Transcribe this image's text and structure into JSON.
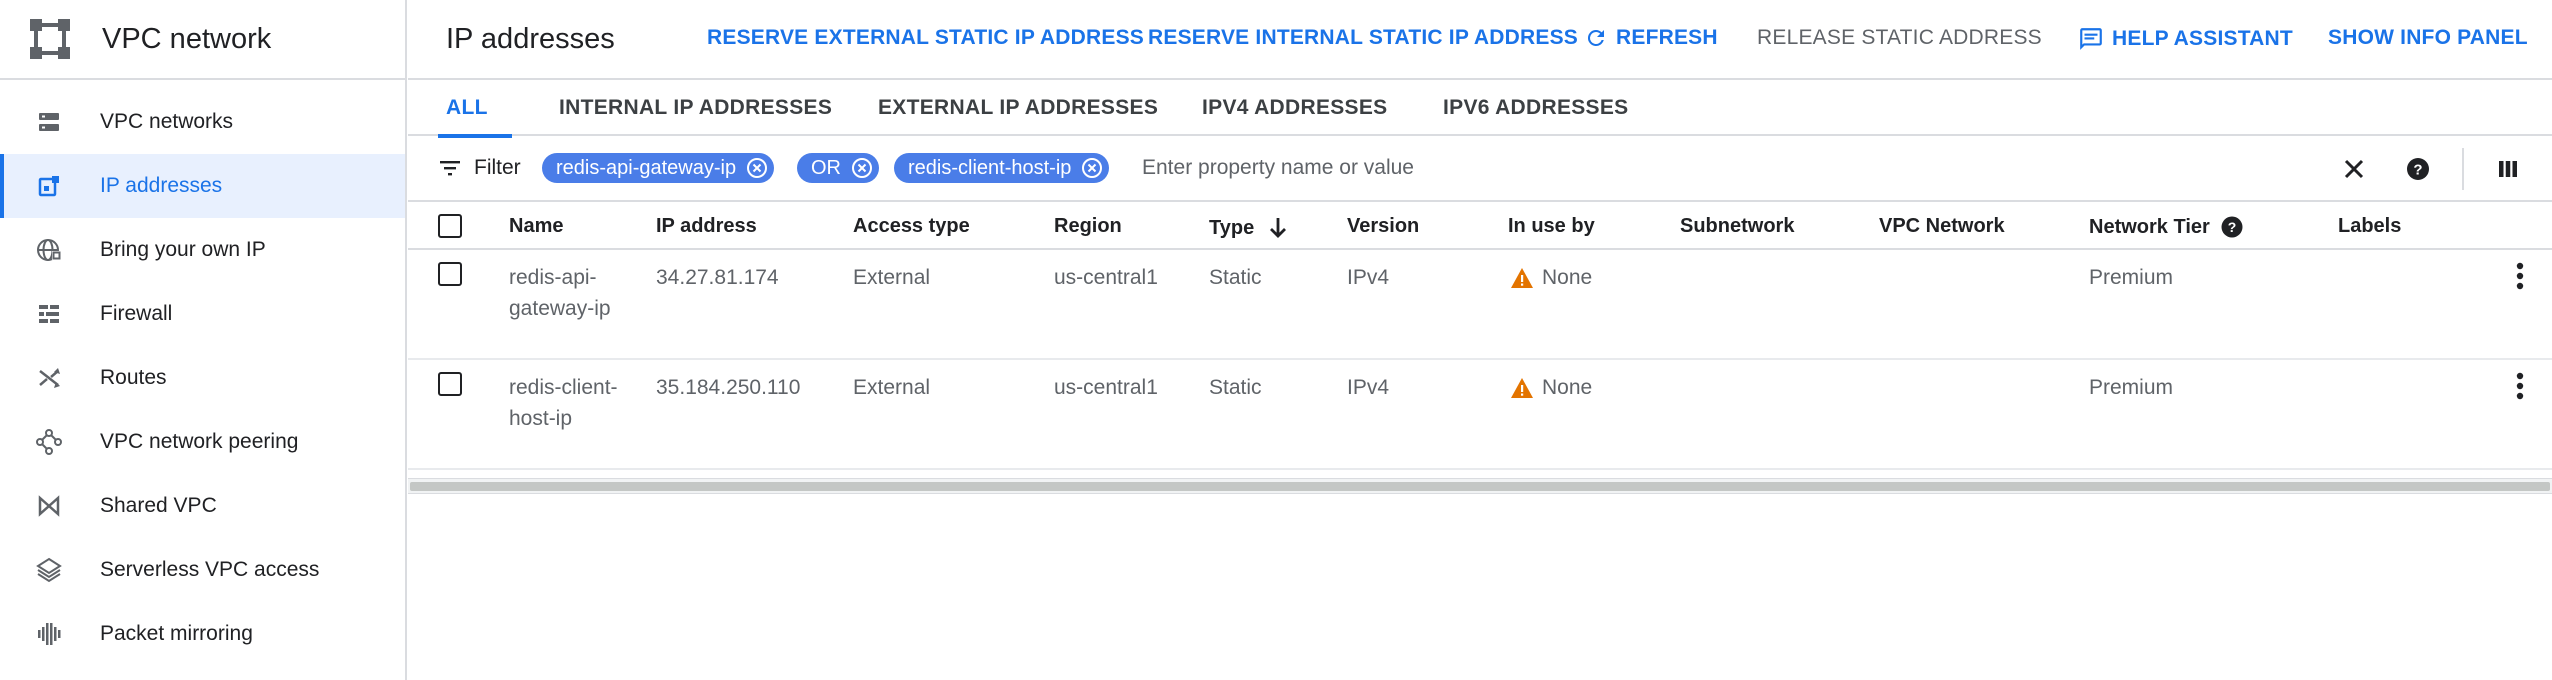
{
  "sidebar": {
    "product_title": "VPC network",
    "items": [
      {
        "label": "VPC networks",
        "icon": "vpc-networks-icon"
      },
      {
        "label": "IP addresses",
        "icon": "ip-addresses-icon"
      },
      {
        "label": "Bring your own IP",
        "icon": "globe-icon"
      },
      {
        "label": "Firewall",
        "icon": "firewall-icon"
      },
      {
        "label": "Routes",
        "icon": "routes-icon"
      },
      {
        "label": "VPC network peering",
        "icon": "peering-icon"
      },
      {
        "label": "Shared VPC",
        "icon": "shared-vpc-icon"
      },
      {
        "label": "Serverless VPC access",
        "icon": "serverless-icon"
      },
      {
        "label": "Packet mirroring",
        "icon": "packet-mirroring-icon"
      }
    ],
    "active_index": 1
  },
  "header": {
    "title": "IP addresses",
    "actions": {
      "reserve_external": "RESERVE EXTERNAL STATIC IP ADDRESS",
      "reserve_internal": "RESERVE INTERNAL STATIC IP ADDRESS",
      "refresh": "REFRESH",
      "release": "RELEASE STATIC ADDRESS",
      "help_assistant": "HELP ASSISTANT",
      "show_info_panel": "SHOW INFO PANEL"
    }
  },
  "tabs": [
    {
      "label": "ALL",
      "active": true
    },
    {
      "label": "INTERNAL IP ADDRESSES",
      "active": false
    },
    {
      "label": "EXTERNAL IP ADDRESSES",
      "active": false
    },
    {
      "label": "IPV4 ADDRESSES",
      "active": false
    },
    {
      "label": "IPV6 ADDRESSES",
      "active": false
    }
  ],
  "filter": {
    "label": "Filter",
    "chips": [
      "redis-api-gateway-ip",
      "OR",
      "redis-client-host-ip"
    ],
    "placeholder": "Enter property name or value"
  },
  "table": {
    "columns": [
      "Name",
      "IP address",
      "Access type",
      "Region",
      "Type",
      "Version",
      "In use by",
      "Subnetwork",
      "VPC Network",
      "Network Tier",
      "Labels"
    ],
    "sort_column": "Type",
    "rows": [
      {
        "name": "redis-api-gateway-ip",
        "ip": "34.27.81.174",
        "access": "External",
        "region": "us-central1",
        "type": "Static",
        "version": "IPv4",
        "in_use_by": "None",
        "subnetwork": "",
        "vpc_network": "",
        "tier": "Premium",
        "labels": ""
      },
      {
        "name": "redis-client-host-ip",
        "ip": "35.184.250.110",
        "access": "External",
        "region": "us-central1",
        "type": "Static",
        "version": "IPv4",
        "in_use_by": "None",
        "subnetwork": "",
        "vpc_network": "",
        "tier": "Premium",
        "labels": ""
      }
    ]
  },
  "colors": {
    "accent": "#1a73e8",
    "chip": "#4a7de8",
    "warning": "#e37400",
    "active_bg": "#e8f0fe"
  }
}
